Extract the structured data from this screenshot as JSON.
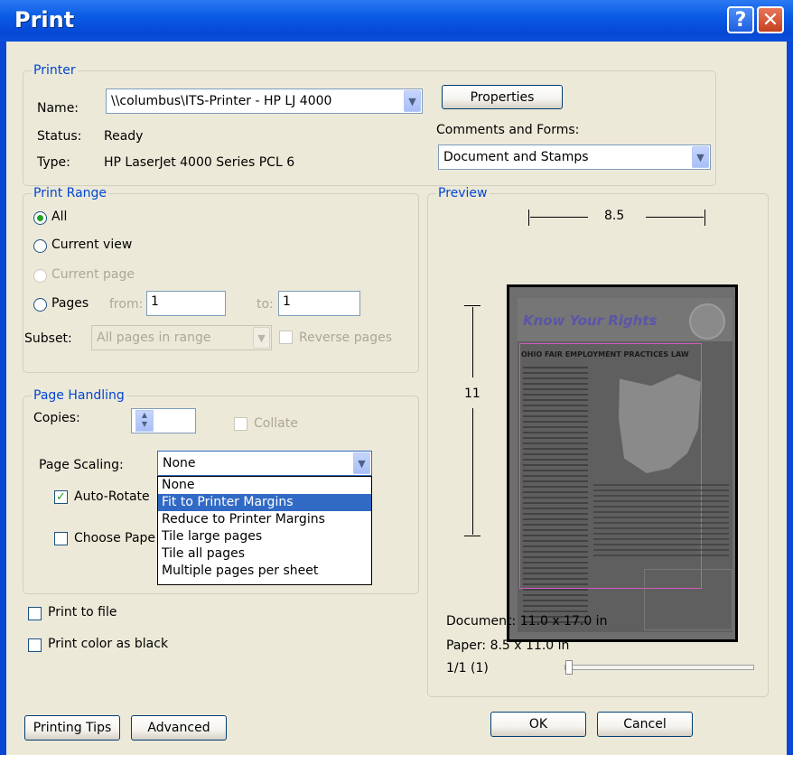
{
  "window": {
    "title": "Print"
  },
  "printer": {
    "legend": "Printer",
    "name_label": "Name:",
    "name_value": "\\\\columbus\\ITS-Printer - HP LJ 4000",
    "status_label": "Status:",
    "status_value": "Ready",
    "type_label": "Type:",
    "type_value": "HP LaserJet 4000 Series PCL 6",
    "properties_label": "Properties",
    "comments_label": "Comments and Forms:",
    "comments_value": "Document and Stamps"
  },
  "print_range": {
    "legend": "Print Range",
    "all_label": "All",
    "current_view_label": "Current view",
    "current_page_label": "Current page",
    "pages_label": "Pages",
    "from_label": "from:",
    "from_value": "1",
    "to_label": "to:",
    "to_value": "1",
    "subset_label": "Subset:",
    "subset_value": "All pages in range",
    "reverse_label": "Reverse pages",
    "selected": "All"
  },
  "page_handling": {
    "legend": "Page Handling",
    "copies_label": "Copies:",
    "copies_value": "1",
    "collate_label": "Collate",
    "scaling_label": "Page Scaling:",
    "scaling_value": "None",
    "auto_rotate_label": "Auto-Rotate",
    "auto_rotate_checked": true,
    "choose_paper_label": "Choose Pape",
    "scaling_options": [
      "None",
      "Fit to Printer Margins",
      "Reduce to Printer Margins",
      "Tile large pages",
      "Tile all pages",
      "Multiple pages per sheet"
    ],
    "highlighted_option": "Fit to Printer Margins"
  },
  "options": {
    "print_to_file_label": "Print to file",
    "print_color_black_label": "Print color as black"
  },
  "preview": {
    "legend": "Preview",
    "width_dim": "8.5",
    "height_dim": "11",
    "document_size": "Document: 11.0 x 17.0 in",
    "paper_size": "Paper: 8.5 x 11.0 in",
    "page_counter": "1/1 (1)",
    "page_title": "Know Your Rights",
    "page_heading": "OHIO FAIR EMPLOYMENT PRACTICES LAW"
  },
  "buttons": {
    "printing_tips": "Printing Tips",
    "advanced": "Advanced",
    "ok": "OK",
    "cancel": "Cancel"
  },
  "icons": {
    "help": "help-icon",
    "close": "close-icon",
    "dropdown_arrow": "chevron-down-icon",
    "spin": "spin-updown-icon"
  }
}
